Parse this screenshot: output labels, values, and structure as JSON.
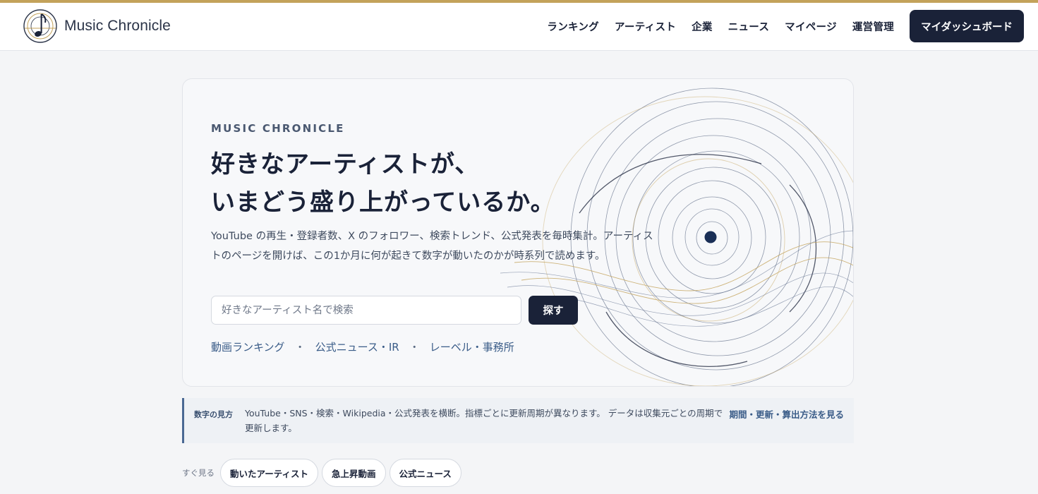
{
  "colors": {
    "accent_gold": "#c3a25a",
    "navy": "#1a2238",
    "link_blue": "#3a5c88",
    "page_bg": "#f4f5f7"
  },
  "header": {
    "logo_icon": "music-note-disc-icon",
    "logo_text": "Music Chronicle",
    "nav": [
      "ランキング",
      "アーティスト",
      "企業",
      "ニュース",
      "マイページ",
      "運営管理"
    ],
    "cta_label": "マイダッシュボード"
  },
  "hero": {
    "eyebrow": "MUSIC CHRONICLE",
    "title_line1": "好きなアーティストが、",
    "title_line2": "いまどう盛り上がっているか。",
    "description": "YouTube の再生・登録者数、X のフォロワー、検索トレンド、公式発表を毎時集計。アーティストのページを開けば、この1か月に何が起きて数字が動いたのかが時系列で読めます。",
    "search_placeholder": "好きなアーティスト名で検索",
    "search_value": "",
    "search_button": "探す",
    "quick_links": [
      "動画ランキング",
      "公式ニュース・IR",
      "レーベル・事務所"
    ],
    "separator": "・"
  },
  "note": {
    "label": "数字の見方",
    "text": "YouTube・SNS・検索・Wikipedia・公式発表を横断。指標ごとに更新周期が異なります。 データは収集元ごとの周期で更新します。",
    "link": "期間・更新・算出方法を見る"
  },
  "quick_access": {
    "label": "すぐ見る",
    "chips": [
      "動いたアーティスト",
      "急上昇動画",
      "公式ニュース"
    ]
  }
}
